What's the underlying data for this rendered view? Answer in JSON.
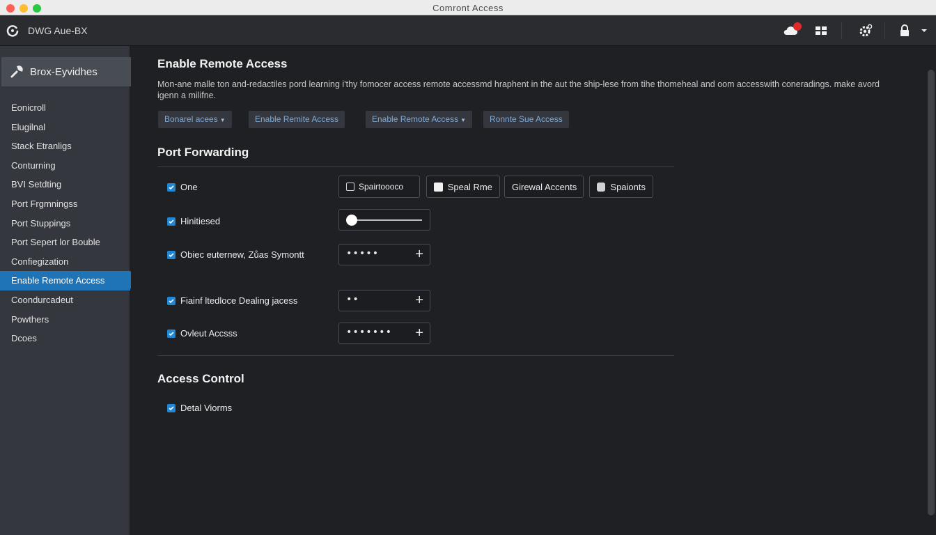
{
  "window": {
    "title": "Comront Access"
  },
  "header": {
    "app_name": "DWG Aue-BX"
  },
  "sidebar": {
    "device_label": "Brox-Eyvidhes",
    "items": [
      {
        "label": "Eonicroll"
      },
      {
        "label": "Elugilnal"
      },
      {
        "label": "Stack Etranligs"
      },
      {
        "label": "Conturning"
      },
      {
        "label": "BVI Setdting"
      },
      {
        "label": "Port Frgmningss"
      },
      {
        "label": "Port Stuppings"
      },
      {
        "label": "Port Sepert lor Bouble"
      },
      {
        "label": "Confiegization"
      },
      {
        "label": "Enable Remote Access"
      },
      {
        "label": "Coondurcadeut"
      },
      {
        "label": "Powthers"
      },
      {
        "label": "Dcoes"
      }
    ],
    "active_index": 9
  },
  "main": {
    "title": "Enable Remote Access",
    "description": "Mon-ane malle ton and-redactiles pord learning i'thy fomocer access remote accessmd hraphent in the aut the ship-lese from tihe thomeheal and oom accesswith coneradings. make avord igenn a milifne.",
    "toolbar": [
      {
        "label": "Bonarel acees",
        "has_caret": true
      },
      {
        "label": "Enable Remite Access",
        "has_caret": false
      },
      {
        "label": "Enable Remote Access",
        "has_caret": true
      },
      {
        "label": "Ronnte Sue Access",
        "has_caret": false
      }
    ],
    "port_forwarding": {
      "title": "Port Forwarding",
      "rows": [
        {
          "label": "One",
          "checked": true
        },
        {
          "label": "Hinitiesed",
          "checked": true
        },
        {
          "label": "Obiec euternew, Zůas Symontt",
          "checked": true
        },
        {
          "label": "Fiainf ltedloce Dealing jacess",
          "checked": true
        },
        {
          "label": "Ovleut Accsss",
          "checked": true
        }
      ],
      "options": [
        {
          "label": "Spairtoooco",
          "style": "outline"
        },
        {
          "label": "Speal Rme",
          "style": "filled"
        },
        {
          "label": "Girewal Accents",
          "style": "none"
        },
        {
          "label": "Spaionts",
          "style": "grey"
        }
      ],
      "slider_value": 0,
      "masked_fields": [
        "•••••",
        "••",
        "•••••••"
      ]
    },
    "access_control": {
      "title": "Access Control",
      "rows": [
        {
          "label": "Detal Viorms",
          "checked": true
        }
      ]
    }
  },
  "colors": {
    "accent": "#1f73b7",
    "checkbox": "#1f87d6",
    "notification": "#e02a2a"
  }
}
